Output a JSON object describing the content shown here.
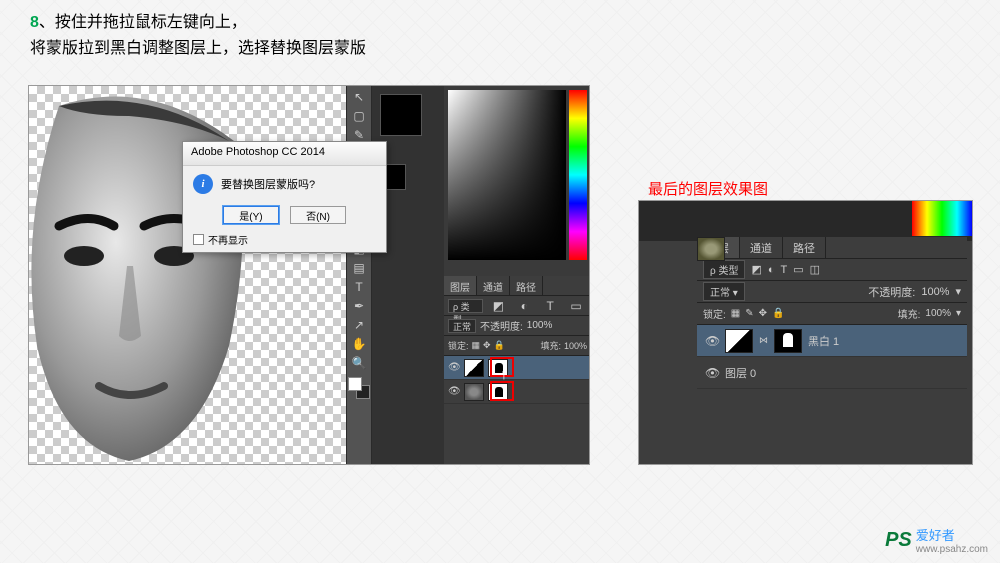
{
  "step": {
    "number": "8",
    "line1": "、按住并拖拉鼠标左键向上，",
    "line2": "将蒙版拉到黑白调整图层上，选择替换图层蒙版"
  },
  "dialog": {
    "title": "Adobe Photoshop CC 2014",
    "message": "要替换图层蒙版吗?",
    "yes": "是(Y)",
    "no": "否(N)",
    "dont_show": "不再显示"
  },
  "panels_left": {
    "tabs": {
      "layers": "图层",
      "channels": "通道",
      "paths": "路径"
    },
    "kind_label": "ρ 类型",
    "blend_mode": "正常",
    "opacity_label": "不透明度:",
    "opacity_value": "100%",
    "lock_label": "锁定:",
    "fill_label": "填充:",
    "fill_value": "100%"
  },
  "right": {
    "title": "最后的图层效果图",
    "tabs": {
      "layers": "图层",
      "channels": "通道",
      "paths": "路径"
    },
    "kind_label": "ρ 类型",
    "blend_mode": "正常",
    "opacity_label": "不透明度:",
    "opacity_value": "100%",
    "lock_label": "锁定:",
    "fill_label": "填充:",
    "fill_value": "100%",
    "layer_bw": "黑白 1",
    "layer_0": "图层 0"
  },
  "watermark": {
    "logo1": "PS",
    "logo2": "爱好者",
    "url": "www.psahz.com"
  },
  "icons": {
    "eye": "👁",
    "search": "🔍",
    "lock": "🔒",
    "tri": "▾",
    "link": "⋈"
  }
}
